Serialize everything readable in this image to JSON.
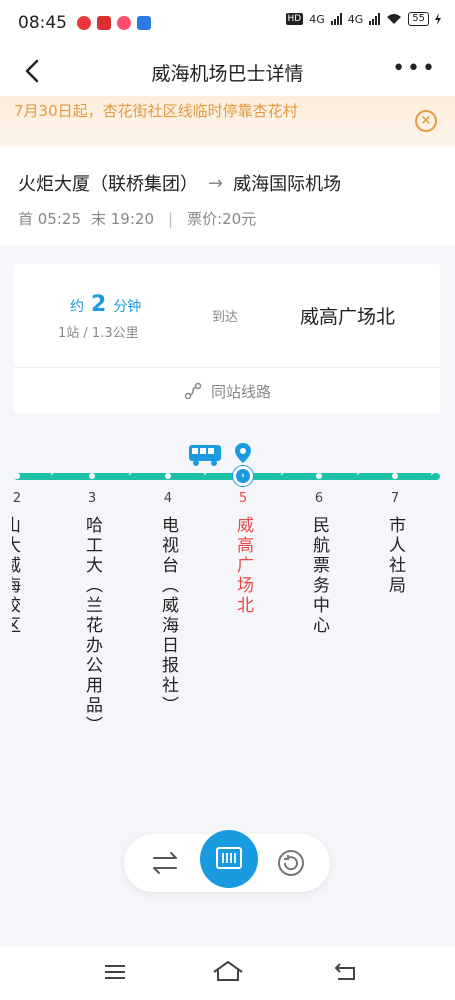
{
  "status": {
    "time": "08:45",
    "hd": "HD",
    "net1": "4G",
    "net2": "4G",
    "battery": "55"
  },
  "nav": {
    "title": "威海机场巴士详情"
  },
  "notice": {
    "text": "7月30日起，杏花街社区线临时停靠杏花村"
  },
  "route": {
    "from": "火炬大厦（联桥集团）",
    "arrow": "→",
    "to": "威海国际机场",
    "first": "首 05:25",
    "last": "末 19:20",
    "sep": "|",
    "price": "票价:20元"
  },
  "arrival": {
    "prefix": "约",
    "minutes": "2",
    "unit": "分钟",
    "sub": "1站 / 1.3公里",
    "label": "到达",
    "station": "威高广场北"
  },
  "same_station": {
    "label": "同站线路"
  },
  "stops": [
    {
      "num": "2",
      "name": "山大威海校区"
    },
    {
      "num": "3",
      "name": "哈工大（兰花办公用品）"
    },
    {
      "num": "4",
      "name": "电视台（威海日报社）"
    },
    {
      "num": "5",
      "name": "威高广场北",
      "active": true
    },
    {
      "num": "6",
      "name": "民航票务中心"
    },
    {
      "num": "7",
      "name": "市人社局"
    }
  ],
  "colors": {
    "accent": "#1a9be0",
    "track": "#1fc0a8",
    "active_stop": "#e84a4a",
    "notice": "#e59a3f"
  }
}
